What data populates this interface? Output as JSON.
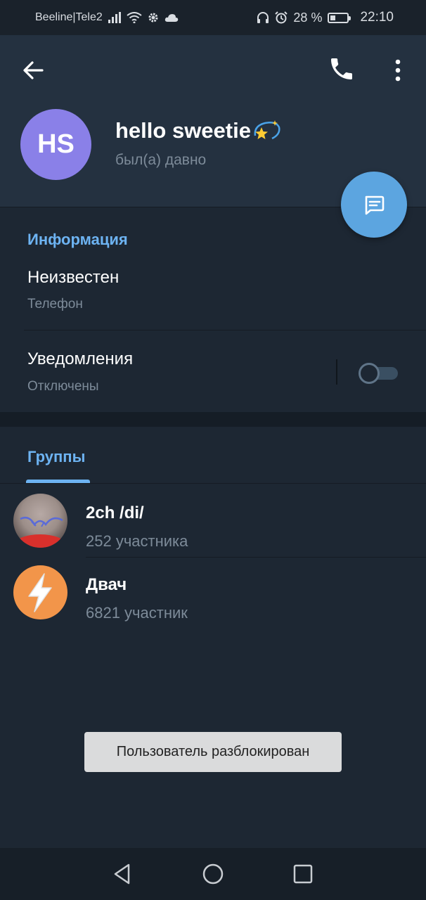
{
  "status_bar": {
    "carrier": "Beeline|Tele2",
    "battery_percent": "28 %",
    "battery_level": 0.28,
    "time": "22:10",
    "icons": [
      "signal-icon",
      "wifi-icon",
      "settings-icon",
      "cloud-icon",
      "headphones-icon",
      "alarm-icon",
      "battery-icon"
    ]
  },
  "header": {
    "avatar_initials": "HS",
    "avatar_color": "#8a80e8",
    "name": "hello sweetie",
    "name_emoji": "💫",
    "status": "был(а) давно",
    "actions": [
      "back-arrow-icon",
      "phone-icon",
      "more-vertical-icon"
    ]
  },
  "info": {
    "title": "Информация",
    "phone_value": "Неизвестен",
    "phone_label": "Телефон",
    "notifications_title": "Уведомления",
    "notifications_status": "Отключены",
    "notifications_enabled": false
  },
  "groups": {
    "tab_label": "Группы",
    "items": [
      {
        "name": "2ch /di/",
        "members": "252 участника"
      },
      {
        "name": "Двач",
        "members": "6821 участник"
      }
    ]
  },
  "toast": {
    "text": "Пользователь разблокирован"
  },
  "colors": {
    "accent": "#6db3f2",
    "fab": "#5ca5e0",
    "background": "#1d2733",
    "header": "#243140"
  }
}
